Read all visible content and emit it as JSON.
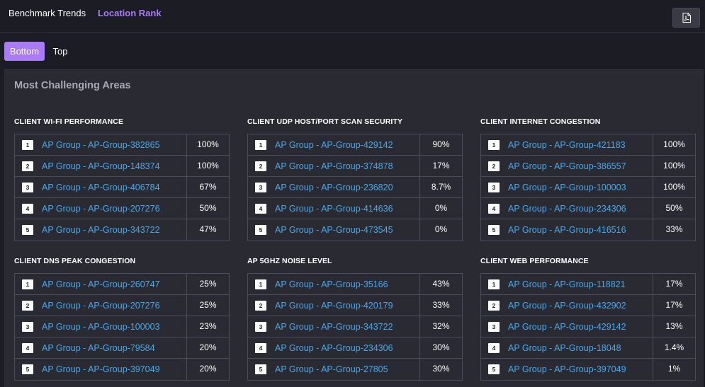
{
  "nav": {
    "tabs": [
      "Benchmark Trends",
      "Location Rank"
    ],
    "active_tab": "Location Rank",
    "export_icon": "pdf-file-icon"
  },
  "toggle": {
    "bottom_label": "Bottom",
    "top_label": "Top",
    "active": "Bottom"
  },
  "panel": {
    "title": "Most Challenging Areas",
    "groups": [
      {
        "title": "CLIENT WI-FI PERFORMANCE",
        "rows": [
          {
            "rank": "1",
            "name": "AP Group - AP-Group-382865",
            "value": "100%"
          },
          {
            "rank": "2",
            "name": "AP Group - AP-Group-148374",
            "value": "100%"
          },
          {
            "rank": "3",
            "name": "AP Group - AP-Group-406784",
            "value": "67%"
          },
          {
            "rank": "4",
            "name": "AP Group - AP-Group-207276",
            "value": "50%"
          },
          {
            "rank": "5",
            "name": "AP Group - AP-Group-343722",
            "value": "47%"
          }
        ]
      },
      {
        "title": "CLIENT UDP HOST/PORT SCAN SECURITY",
        "rows": [
          {
            "rank": "1",
            "name": "AP Group - AP-Group-429142",
            "value": "90%"
          },
          {
            "rank": "2",
            "name": "AP Group - AP-Group-374878",
            "value": "17%"
          },
          {
            "rank": "3",
            "name": "AP Group - AP-Group-236820",
            "value": "8.7%"
          },
          {
            "rank": "4",
            "name": "AP Group - AP-Group-414636",
            "value": "0%"
          },
          {
            "rank": "5",
            "name": "AP Group - AP-Group-473545",
            "value": "0%"
          }
        ]
      },
      {
        "title": "CLIENT INTERNET CONGESTION",
        "rows": [
          {
            "rank": "1",
            "name": "AP Group - AP-Group-421183",
            "value": "100%"
          },
          {
            "rank": "2",
            "name": "AP Group - AP-Group-386557",
            "value": "100%"
          },
          {
            "rank": "3",
            "name": "AP Group - AP-Group-100003",
            "value": "100%"
          },
          {
            "rank": "4",
            "name": "AP Group - AP-Group-234306",
            "value": "50%"
          },
          {
            "rank": "5",
            "name": "AP Group - AP-Group-416516",
            "value": "33%"
          }
        ]
      },
      {
        "title": "CLIENT DNS PEAK CONGESTION",
        "rows": [
          {
            "rank": "1",
            "name": "AP Group - AP-Group-260747",
            "value": "25%"
          },
          {
            "rank": "2",
            "name": "AP Group - AP-Group-207276",
            "value": "25%"
          },
          {
            "rank": "3",
            "name": "AP Group - AP-Group-100003",
            "value": "23%"
          },
          {
            "rank": "4",
            "name": "AP Group - AP-Group-79584",
            "value": "20%"
          },
          {
            "rank": "5",
            "name": "AP Group - AP-Group-397049",
            "value": "20%"
          }
        ]
      },
      {
        "title": "AP 5GHZ NOISE LEVEL",
        "rows": [
          {
            "rank": "1",
            "name": "AP Group - AP-Group-35166",
            "value": "43%"
          },
          {
            "rank": "2",
            "name": "AP Group - AP-Group-420179",
            "value": "33%"
          },
          {
            "rank": "3",
            "name": "AP Group - AP-Group-343722",
            "value": "32%"
          },
          {
            "rank": "4",
            "name": "AP Group - AP-Group-234306",
            "value": "30%"
          },
          {
            "rank": "5",
            "name": "AP Group - AP-Group-27805",
            "value": "30%"
          }
        ]
      },
      {
        "title": "CLIENT WEB PERFORMANCE",
        "rows": [
          {
            "rank": "1",
            "name": "AP Group - AP-Group-118821",
            "value": "17%"
          },
          {
            "rank": "2",
            "name": "AP Group - AP-Group-432902",
            "value": "17%"
          },
          {
            "rank": "3",
            "name": "AP Group - AP-Group-429142",
            "value": "13%"
          },
          {
            "rank": "4",
            "name": "AP Group - AP-Group-18048",
            "value": "1.4%"
          },
          {
            "rank": "5",
            "name": "AP Group - AP-Group-397049",
            "value": "1%"
          }
        ]
      }
    ]
  },
  "colors": {
    "accent": "#a97cf5",
    "link": "#4aa8ea",
    "background": "#1c1c24",
    "panel": "#2a2a33"
  }
}
